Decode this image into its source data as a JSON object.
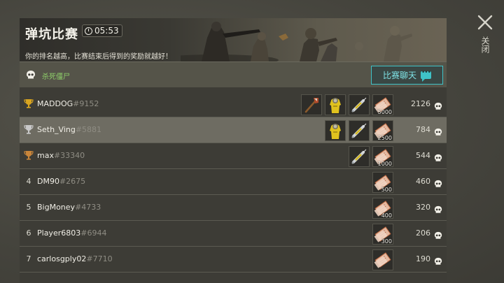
{
  "event": {
    "title": "弹坑比赛",
    "timer": "05:53",
    "subtitle": "你的排名越高，比赛结束后得到的奖励就越好！"
  },
  "objective": {
    "label": "杀死僵尸"
  },
  "chat_button": {
    "label": "比赛聊天"
  },
  "close": {
    "label": "关闭"
  },
  "colors": {
    "objective_text": "#8fd06a",
    "chat_accent": "#3fc3c8",
    "gold_trophy": "#d9a520",
    "silver_trophy": "#c9c9c9",
    "bronze_trophy": "#c9853a"
  },
  "leaderboard": [
    {
      "rank": "1",
      "rank_icon": "gold-trophy-icon",
      "name": "MADDOG",
      "tag": "#9152",
      "score": "2126",
      "rewards": [
        {
          "icon": "axe-icon"
        },
        {
          "icon": "hazmat-suit-icon"
        },
        {
          "icon": "syringe-icon"
        },
        {
          "icon": "coupon-icon",
          "qty": "5000"
        }
      ]
    },
    {
      "rank": "2",
      "rank_icon": "silver-trophy-icon",
      "name": "Seth_Ving",
      "tag": "#5881",
      "score": "784",
      "rewards": [
        {
          "icon": "hazmat-suit-icon"
        },
        {
          "icon": "syringe-icon"
        },
        {
          "icon": "coupon-icon",
          "qty": "2500"
        }
      ]
    },
    {
      "rank": "3",
      "rank_icon": "bronze-trophy-icon",
      "name": "max",
      "tag": "#33340",
      "score": "544",
      "rewards": [
        {
          "icon": "syringe-icon"
        },
        {
          "icon": "coupon-icon",
          "qty": "1000"
        }
      ]
    },
    {
      "rank": "4",
      "name": "DM90",
      "tag": "#2675",
      "score": "460",
      "rewards": [
        {
          "icon": "coupon-icon",
          "qty": "500"
        }
      ]
    },
    {
      "rank": "5",
      "name": "BigMoney",
      "tag": "#4733",
      "score": "320",
      "rewards": [
        {
          "icon": "coupon-icon",
          "qty": "400"
        }
      ]
    },
    {
      "rank": "6",
      "name": "Player6803",
      "tag": "#6944",
      "score": "206",
      "rewards": [
        {
          "icon": "coupon-icon",
          "qty": "300"
        }
      ]
    },
    {
      "rank": "7",
      "name": "carlosgply02",
      "tag": "#7710",
      "score": "190",
      "rewards": [
        {
          "icon": "coupon-icon",
          "qty": ""
        }
      ]
    }
  ]
}
